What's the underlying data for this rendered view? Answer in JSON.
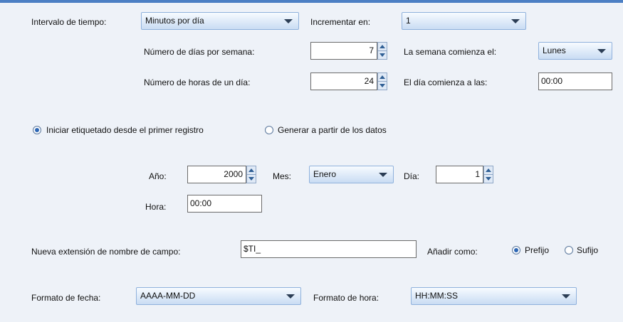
{
  "interval": {
    "label": "Intervalo de tiempo:",
    "value": "Minutos por día",
    "increment_label": "Incrementar en:",
    "increment_value": "1",
    "days_per_week_label": "Número de días por semana:",
    "days_per_week_value": "7",
    "week_starts_label": "La semana comienza el:",
    "week_starts_value": "Lunes",
    "hours_per_day_label": "Número de horas de un día:",
    "hours_per_day_value": "24",
    "day_starts_label": "El día comienza a las:",
    "day_starts_value": "00:00"
  },
  "labeling": {
    "option_first_record": "Iniciar etiquetado desde el primer registro",
    "option_from_data": "Generar a partir de los datos",
    "selected": "first_record",
    "year_label": "Año:",
    "year_value": "2000",
    "month_label": "Mes:",
    "month_value": "Enero",
    "day_label": "Día:",
    "day_value": "1",
    "hour_label": "Hora:",
    "hour_value": "00:00"
  },
  "extension": {
    "label": "Nueva extensión de nombre de campo:",
    "value": "$TI_",
    "add_as_label": "Añadir como:",
    "prefix_label": "Prefijo",
    "suffix_label": "Sufijo",
    "selected": "prefix"
  },
  "formats": {
    "date_label": "Formato de fecha:",
    "date_value": "AAAA-MM-DD",
    "time_label": "Formato de hora:",
    "time_value": "HH:MM:SS"
  }
}
